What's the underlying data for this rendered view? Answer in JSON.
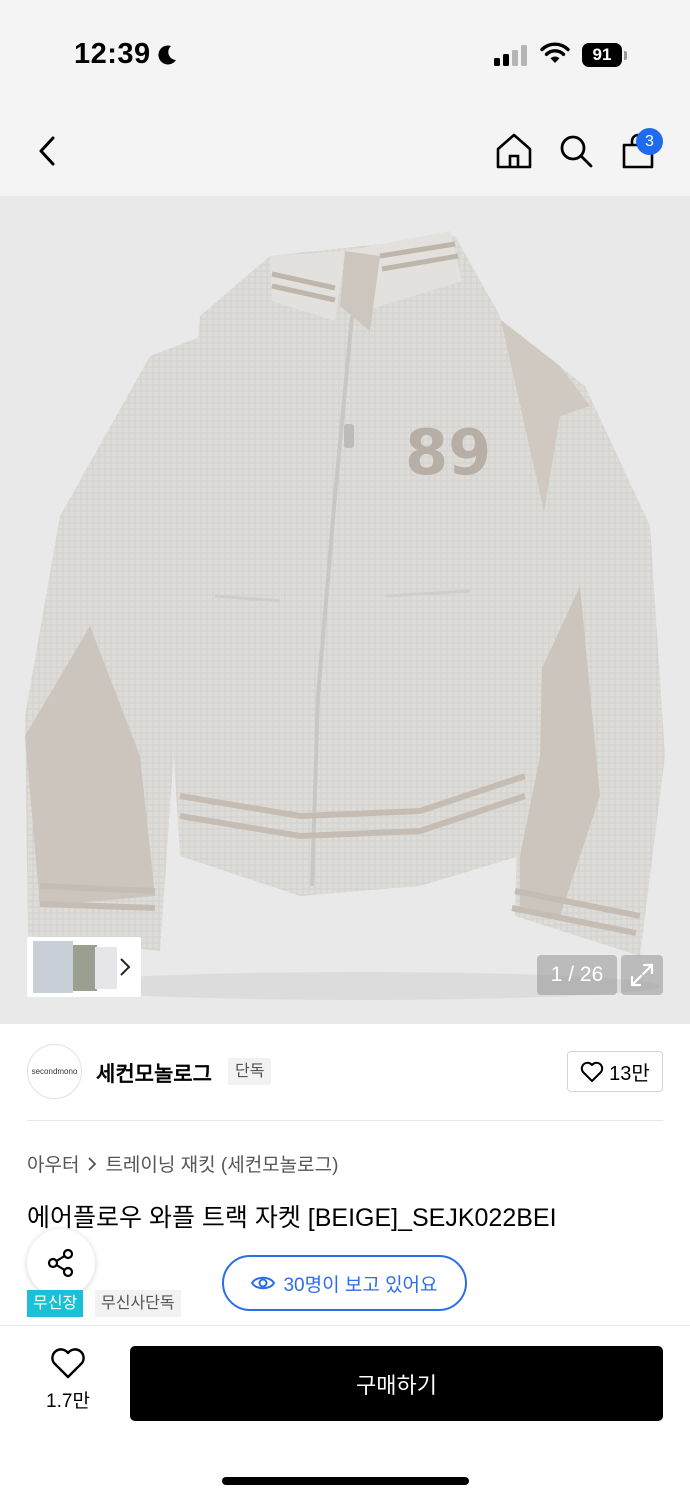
{
  "status_bar": {
    "time": "12:39",
    "battery": "91",
    "icons": [
      "moon-icon",
      "signal-icon",
      "wifi-icon",
      "battery-icon"
    ]
  },
  "header": {
    "icons": [
      "back-icon",
      "home-icon",
      "search-icon",
      "cart-icon"
    ],
    "cart_count": "3"
  },
  "gallery": {
    "counter": "1 / 26",
    "patch_text": "89"
  },
  "brand": {
    "logo_text": "secondmono",
    "name": "세컨모놀로그",
    "tag": "단독",
    "likes": "13만"
  },
  "breadcrumb": {
    "category": "아우터",
    "subcategory": "트레이닝 재킷 (세컨모놀로그)"
  },
  "product": {
    "title": "에어플로우 와플 트랙 자켓 [BEIGE]_SEJK022BEI"
  },
  "viewers": {
    "text": "30명이 보고 있어요"
  },
  "badges": {
    "primary": "무신장",
    "secondary": "무신사단독"
  },
  "bottom": {
    "wish_count": "1.7만",
    "buy_label": "구매하기"
  },
  "colors": {
    "accent_blue": "#2b6ee8",
    "badge_cyan": "#19c0d6",
    "cart_badge": "#1e6bf0"
  }
}
